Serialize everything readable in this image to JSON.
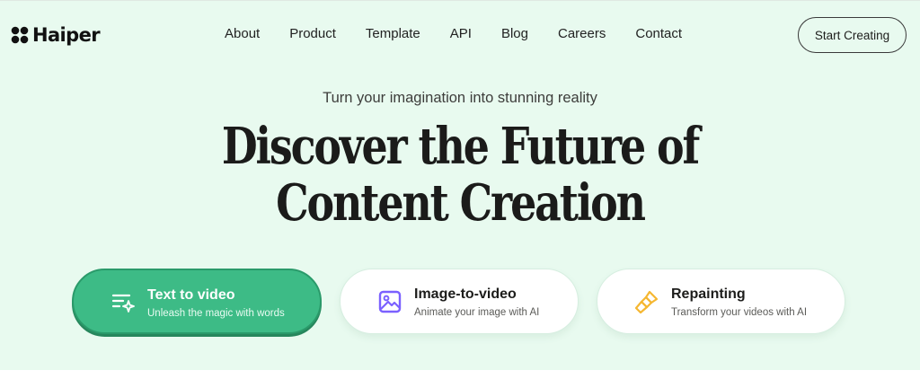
{
  "header": {
    "logo_text": "Haiper",
    "nav": [
      "About",
      "Product",
      "Template",
      "API",
      "Blog",
      "Careers",
      "Contact"
    ],
    "cta_label": "Start Creating"
  },
  "hero": {
    "subtitle": "Turn your imagination into stunning reality",
    "headline_line1": "Discover the Future of",
    "headline_line2": "Content Creation"
  },
  "cards": [
    {
      "title": "Text to video",
      "desc": "Unleash the magic with words",
      "icon": "text-sparkle-icon"
    },
    {
      "title": "Image-to-video",
      "desc": "Animate your image with AI",
      "icon": "image-icon"
    },
    {
      "title": "Repainting",
      "desc": "Transform your videos with AI",
      "icon": "paintbrush-icon"
    }
  ],
  "colors": {
    "hero_bg": "#e8faef",
    "accent_green": "#3dbb86",
    "image_icon": "#7b61ff",
    "brush_icon": "#f5b731"
  }
}
